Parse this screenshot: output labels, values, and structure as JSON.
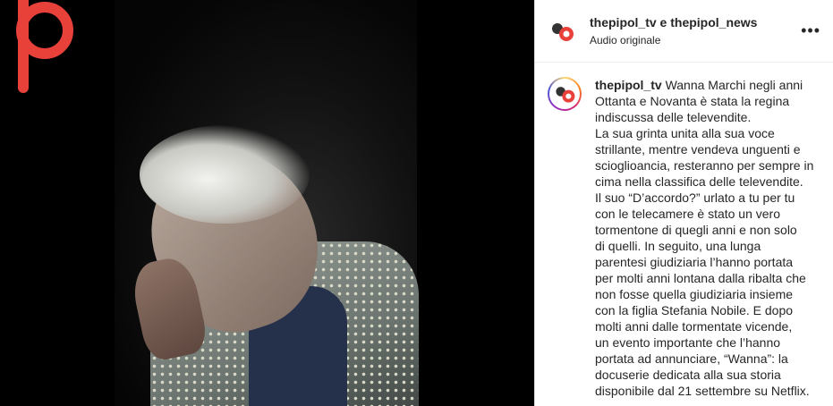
{
  "post": {
    "header_title": "thepipol_tv e thepipol_news",
    "header_subtitle": "Audio originale",
    "more_label": "•••",
    "caption_user": "thepipol_tv",
    "caption_lines": [
      "Wanna Marchi negli anni",
      "Ottanta e Novanta è stata la regina",
      "indiscussa delle televendite.",
      "La sua grinta unita alla sua voce",
      "strillante, mentre vendeva unguenti e",
      "scioglioancia, resteranno per sempre in",
      "cima nella classifica delle televendite.",
      "Il suo “D’accordo?” urlato a tu per tu",
      "con le telecamere è stato un vero",
      "tormentone di quegli anni e non solo",
      "di quelli. In seguito, una lunga",
      "parentesi giudiziaria l’hanno portata",
      "per molti anni lontana dalla ribalta che",
      "non fosse quella giudiziaria insieme",
      "con la figlia Stefania Nobile. E dopo",
      "molti anni dalle tormentate vicende,",
      "un evento importante che l’hanno",
      "portata ad annunciare, “Wanna”: la",
      "docuserie dedicata alla sua storia",
      "disponibile dal 21 settembre su Netflix."
    ]
  },
  "colors": {
    "brand_red": "#e8413a",
    "text": "#262626"
  },
  "icons": {
    "brand": "thepipol-p-logo-icon",
    "more": "more-options-icon"
  }
}
